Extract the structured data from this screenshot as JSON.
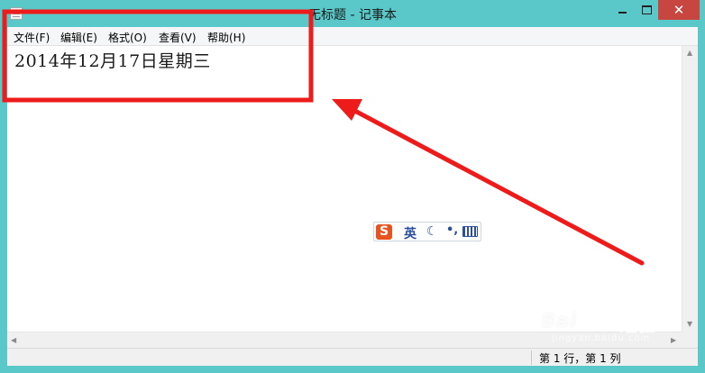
{
  "window": {
    "title": "无标题 - 记事本",
    "controls": {
      "minimize": "",
      "maximize": "",
      "close": "✕"
    }
  },
  "menu": {
    "items": [
      "文件(F)",
      "编辑(E)",
      "格式(O)",
      "查看(V)",
      "帮助(H)"
    ]
  },
  "editor": {
    "content": "2014年12月17日星期三"
  },
  "statusbar": {
    "position": "第 1 行，第 1 列"
  },
  "ime": {
    "logo": "S",
    "language": "英",
    "mode_icon": "moon-icon",
    "punct_icon": "punctuation-icon",
    "keyboard_icon": "keyboard-icon"
  },
  "watermark": {
    "brand": "Bai",
    "brand_suffix": "经验",
    "url": "jingyan.baidu.com"
  },
  "colors": {
    "window_frame": "#5ac8c8",
    "annotation": "#ee1b1b",
    "close_button": "#c7463f",
    "ime_logo": "#e8531f"
  }
}
